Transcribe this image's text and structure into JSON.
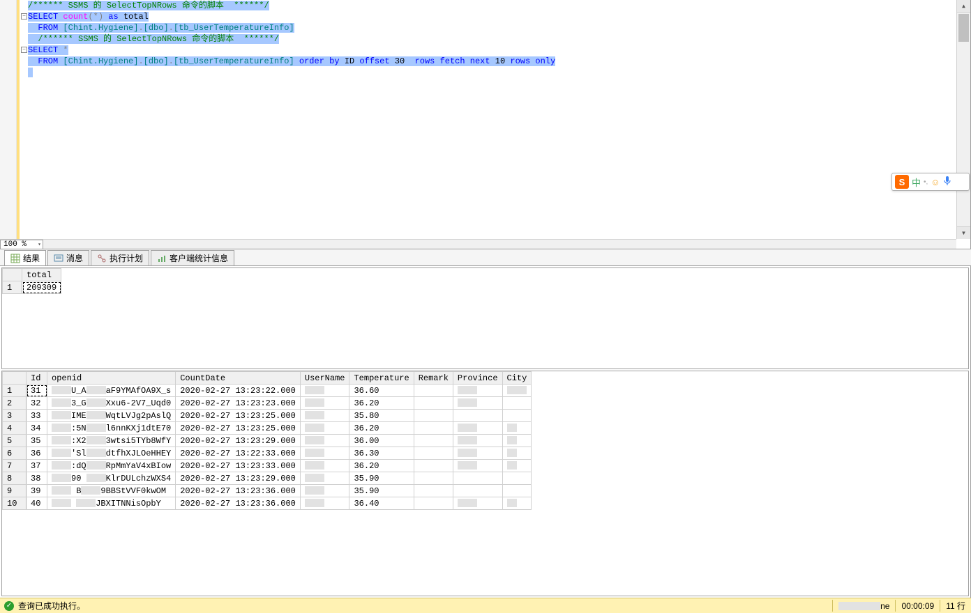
{
  "editor": {
    "zoom": "100 %",
    "lines": [
      {
        "indent": 0,
        "fold": false,
        "sel": true,
        "tokens": [
          {
            "c": "kw-green",
            "t": "/****** SSMS 的 SelectTopNRows 命令的脚本  ******/"
          }
        ]
      },
      {
        "indent": 0,
        "fold": true,
        "sel": true,
        "tokens": [
          {
            "c": "kw-blue",
            "t": "SELECT "
          },
          {
            "c": "kw-magenta",
            "t": "count"
          },
          {
            "c": "kw-gray",
            "t": "("
          },
          {
            "c": "kw-gray",
            "t": "*"
          },
          {
            "c": "kw-gray",
            "t": ")"
          },
          {
            "c": "kw-blue",
            "t": " as "
          },
          {
            "c": "kw-black",
            "t": "total"
          }
        ]
      },
      {
        "indent": 1,
        "fold": false,
        "sel": true,
        "tokens": [
          {
            "c": "kw-blue",
            "t": "  FROM "
          },
          {
            "c": "kw-teal",
            "t": "[Chint.Hygiene]"
          },
          {
            "c": "kw-gray",
            "t": "."
          },
          {
            "c": "kw-teal",
            "t": "[dbo]"
          },
          {
            "c": "kw-gray",
            "t": "."
          },
          {
            "c": "kw-teal",
            "t": "[tb_UserTemperatureInfo]"
          }
        ]
      },
      {
        "indent": 1,
        "fold": false,
        "sel": true,
        "tokens": [
          {
            "c": "kw-green",
            "t": "  /****** SSMS 的 SelectTopNRows 命令的脚本  ******/"
          }
        ]
      },
      {
        "indent": 0,
        "fold": true,
        "sel": true,
        "tokens": [
          {
            "c": "kw-blue",
            "t": "SELECT "
          },
          {
            "c": "kw-gray",
            "t": "*"
          }
        ]
      },
      {
        "indent": 1,
        "fold": false,
        "sel": true,
        "tokens": [
          {
            "c": "kw-blue",
            "t": "  FROM "
          },
          {
            "c": "kw-teal",
            "t": "[Chint.Hygiene]"
          },
          {
            "c": "kw-gray",
            "t": "."
          },
          {
            "c": "kw-teal",
            "t": "[dbo]"
          },
          {
            "c": "kw-gray",
            "t": "."
          },
          {
            "c": "kw-teal",
            "t": "[tb_UserTemperatureInfo]"
          },
          {
            "c": "kw-blue",
            "t": " order by "
          },
          {
            "c": "kw-black",
            "t": "ID "
          },
          {
            "c": "kw-blue",
            "t": "offset "
          },
          {
            "c": "kw-black",
            "t": "30  "
          },
          {
            "c": "kw-blue",
            "t": "rows fetch next "
          },
          {
            "c": "kw-black",
            "t": "10 "
          },
          {
            "c": "kw-blue",
            "t": "rows only"
          }
        ]
      },
      {
        "indent": 0,
        "fold": false,
        "sel": true,
        "tokens": [
          {
            "c": "kw-black",
            "t": " "
          }
        ]
      }
    ]
  },
  "tabs": {
    "results": "结果",
    "messages": "消息",
    "plan": "执行计划",
    "stats": "客户端统计信息"
  },
  "results1": {
    "columns": [
      "total"
    ],
    "rows": [
      {
        "n": "1",
        "cells": [
          "209309"
        ]
      }
    ]
  },
  "results2": {
    "columns": [
      "Id",
      "openid",
      "CountDate",
      "UserName",
      "Temperature",
      "Remark",
      "Province",
      "City"
    ],
    "widths": [
      30,
      170,
      150,
      55,
      66,
      44,
      48,
      30
    ],
    "rows": [
      {
        "n": "1",
        "cells": [
          "31",
          "██U_A██aF9YMAfOA9X_s",
          "2020-02-27 13:23:22.000",
          "██",
          "36.60",
          "",
          "██",
          "██"
        ]
      },
      {
        "n": "2",
        "cells": [
          "32",
          "██3_G██Xxu6-2V7_Uqd0",
          "2020-02-27 13:23:23.000",
          "██",
          "36.20",
          "",
          "██",
          ""
        ]
      },
      {
        "n": "3",
        "cells": [
          "33",
          "██IME██WqtLVJg2pAslQ",
          "2020-02-27 13:23:25.000",
          "██",
          "35.80",
          "",
          "",
          ""
        ]
      },
      {
        "n": "4",
        "cells": [
          "34",
          "██:5N██l6nnKXj1dtE70",
          "2020-02-27 13:23:25.000",
          "██",
          "36.20",
          "",
          "██",
          "█"
        ]
      },
      {
        "n": "5",
        "cells": [
          "35",
          "██:X2██3wtsi5TYb8WfY",
          "2020-02-27 13:23:29.000",
          "██",
          "36.00",
          "",
          "██",
          "█"
        ]
      },
      {
        "n": "6",
        "cells": [
          "36",
          "██'Sl██dtfhXJLOeHHEY",
          "2020-02-27 13:22:33.000",
          "██",
          "36.30",
          "",
          "██",
          "█"
        ]
      },
      {
        "n": "7",
        "cells": [
          "37",
          "██:dQ██RpMmYaV4xBIow",
          "2020-02-27 13:23:33.000",
          "██",
          "36.20",
          "",
          "██",
          "█"
        ]
      },
      {
        "n": "8",
        "cells": [
          "38",
          "██90 ██KlrDULchzWXS4",
          "2020-02-27 13:23:29.000",
          "██",
          "35.90",
          "",
          "",
          ""
        ]
      },
      {
        "n": "9",
        "cells": [
          "39",
          "██  B██9BBStVVF0kwOM",
          "2020-02-27 13:23:36.000",
          "██",
          "35.90",
          "",
          "",
          ""
        ]
      },
      {
        "n": "10",
        "cells": [
          "40",
          "██   ██JBXITNNisOpbY",
          "2020-02-27 13:23:36.000",
          "██",
          "36.40",
          "",
          "██",
          "█"
        ]
      }
    ]
  },
  "status": {
    "message": "查询已成功执行。",
    "conn_tail": "ne",
    "elapsed": "00:00:09",
    "rows": "11 行"
  },
  "ime": {
    "logo": "S",
    "lang": "中"
  }
}
